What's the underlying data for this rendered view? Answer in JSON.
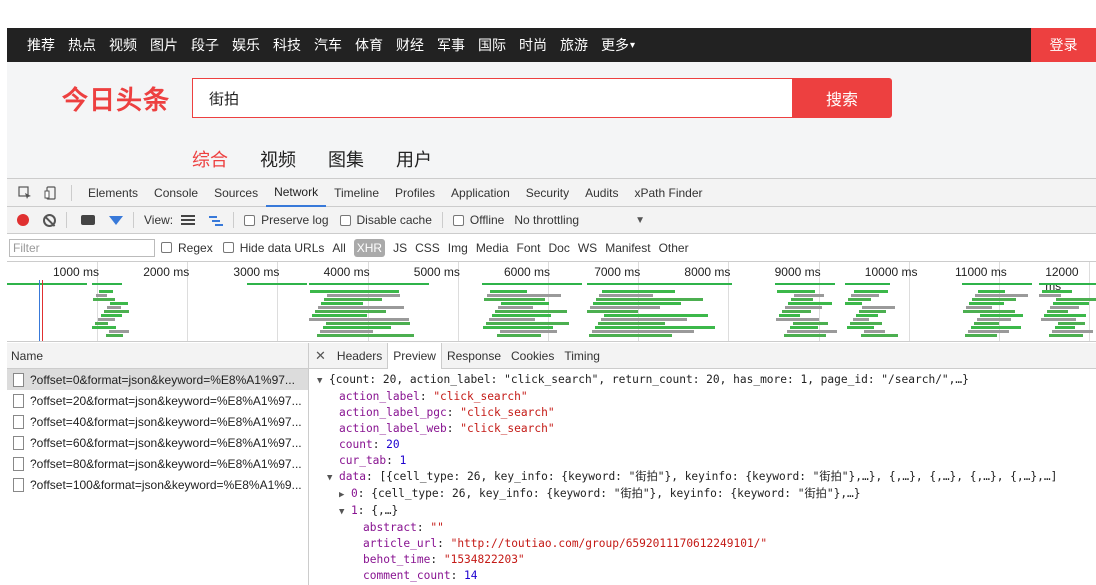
{
  "topnav": {
    "items": [
      "推荐",
      "热点",
      "视频",
      "图片",
      "段子",
      "娱乐",
      "科技",
      "汽车",
      "体育",
      "财经",
      "军事",
      "国际",
      "时尚",
      "旅游",
      "更多"
    ],
    "login_label": "登录"
  },
  "header": {
    "logo_text": "今日头条",
    "search_value": "街拍",
    "search_button_label": "搜索",
    "tabs": [
      "综合",
      "视频",
      "图集",
      "用户"
    ]
  },
  "devtools": {
    "tabs": [
      "Elements",
      "Console",
      "Sources",
      "Network",
      "Timeline",
      "Profiles",
      "Application",
      "Security",
      "Audits",
      "xPath Finder"
    ],
    "active_tab": "Network",
    "toolbar": {
      "view_label": "View:",
      "preserve_log": "Preserve log",
      "disable_cache": "Disable cache",
      "offline": "Offline",
      "throttling": "No throttling"
    },
    "filter": {
      "placeholder": "Filter",
      "regex": "Regex",
      "hide_data_urls": "Hide data URLs",
      "types": [
        "All",
        "XHR",
        "JS",
        "CSS",
        "Img",
        "Media",
        "Font",
        "Doc",
        "WS",
        "Manifest",
        "Other"
      ],
      "active_type": "XHR"
    },
    "timeline_labels": [
      "1000 ms",
      "2000 ms",
      "3000 ms",
      "4000 ms",
      "5000 ms",
      "6000 ms",
      "7000 ms",
      "8000 ms",
      "9000 ms",
      "10000 ms",
      "11000 ms",
      "12000 ms"
    ],
    "requests_header": "Name",
    "requests": [
      "?offset=0&format=json&keyword=%E8%A1%97...",
      "?offset=20&format=json&keyword=%E8%A1%97...",
      "?offset=40&format=json&keyword=%E8%A1%97...",
      "?offset=60&format=json&keyword=%E8%A1%97...",
      "?offset=80&format=json&keyword=%E8%A1%97...",
      "?offset=100&format=json&keyword=%E8%A1%9..."
    ],
    "detail_tabs": [
      "Headers",
      "Preview",
      "Response",
      "Cookies",
      "Timing"
    ],
    "active_detail_tab": "Preview",
    "preview": {
      "root": "{count: 20, action_label: \"click_search\", return_count: 20, has_more: 1, page_id: \"/search/\",…}",
      "action_label_key": "action_label",
      "action_label_val": "\"click_search\"",
      "action_label_pgc_key": "action_label_pgc",
      "action_label_pgc_val": "\"click_search\"",
      "action_label_web_key": "action_label_web",
      "action_label_web_val": "\"click_search\"",
      "count_key": "count",
      "count_val": "20",
      "cur_tab_key": "cur_tab",
      "cur_tab_val": "1",
      "data_key": "data",
      "data_val": "[{cell_type: 26, key_info: {keyword: \"街拍\"}, keyinfo: {keyword: \"街拍\"},…}, {,…}, {,…}, {,…}, {,…},…]",
      "item0_key": "0",
      "item0_val": "{cell_type: 26, key_info: {keyword: \"街拍\"}, keyinfo: {keyword: \"街拍\"},…}",
      "item1_key": "1",
      "item1_val": "{,…}",
      "abstract_key": "abstract",
      "abstract_val": "\"\"",
      "article_url_key": "article_url",
      "article_url_val": "\"http://toutiao.com/group/6592011170612249101/\"",
      "behot_time_key": "behot_time",
      "behot_time_val": "\"1534822203\"",
      "comment_count_key": "comment_count",
      "comment_count_val": "14"
    }
  }
}
